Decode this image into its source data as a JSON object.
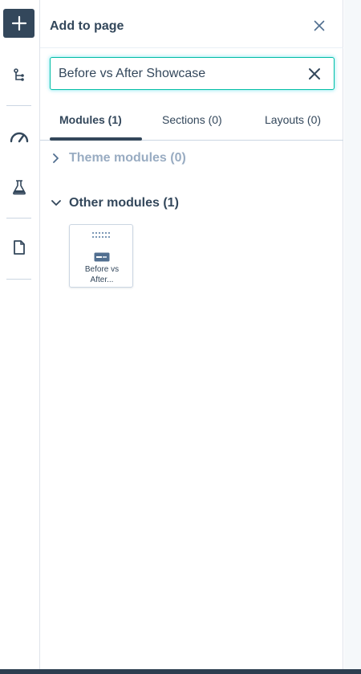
{
  "rail": {
    "items": [
      {
        "icon": "plus-icon"
      },
      {
        "icon": "tree-structure-icon"
      },
      {
        "icon": "speedometer-icon"
      },
      {
        "icon": "flask-icon"
      },
      {
        "icon": "document-icon"
      }
    ]
  },
  "panel": {
    "title": "Add to page",
    "search": {
      "value": "Before vs After Showcase",
      "placeholder": ""
    },
    "tabs": [
      {
        "label": "Modules (1)",
        "active": true
      },
      {
        "label": "Sections (0)",
        "active": false
      },
      {
        "label": "Layouts (0)",
        "active": false
      }
    ],
    "groups": [
      {
        "label": "Theme modules (0)",
        "expanded": false
      },
      {
        "label": "Other modules (1)",
        "expanded": true
      }
    ],
    "modules": [
      {
        "label": "Before vs After..."
      }
    ]
  },
  "colors": {
    "accent": "#00bda5",
    "dark": "#33475b",
    "muted": "#99acc2"
  }
}
